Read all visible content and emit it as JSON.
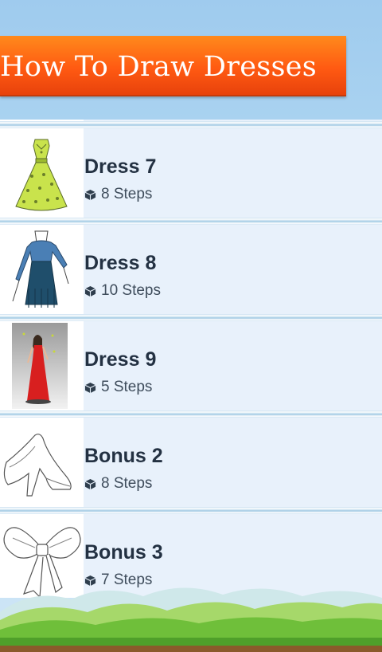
{
  "header": {
    "title": "How To Draw Dresses"
  },
  "items": [
    {
      "title": "Dress 7",
      "steps": "8 Steps",
      "thumbnail": "green-dress-drawing"
    },
    {
      "title": "Dress 8",
      "steps": "10 Steps",
      "thumbnail": "blue-fringe-dress-drawing"
    },
    {
      "title": "Dress 9",
      "steps": "5 Steps",
      "thumbnail": "red-gown-drawing"
    },
    {
      "title": "Bonus 2",
      "steps": "8 Steps",
      "thumbnail": "high-heel-shoe-sketch"
    },
    {
      "title": "Bonus 3",
      "steps": "7 Steps",
      "thumbnail": "bow-sketch"
    }
  ],
  "colors": {
    "banner": "#ff5a12",
    "row_background": "#e8f1fb",
    "title_text": "#233142"
  },
  "icons": {
    "steps": "cube-icon"
  }
}
